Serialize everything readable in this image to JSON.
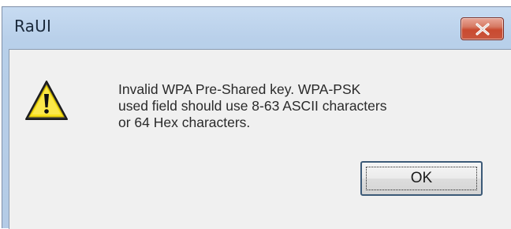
{
  "window": {
    "title": "RaUI",
    "close_icon": "close-icon"
  },
  "dialog": {
    "icon": "warning-icon",
    "message_lines": [
      "Invalid WPA Pre-Shared key. WPA-PSK",
      "used field should use 8-63 ASCII characters",
      "or 64 Hex characters."
    ],
    "ok_label": "OK"
  },
  "colors": {
    "titlebar": "#b9d0ea",
    "client_background": "#f0f0f0",
    "close_button": "#c94a30",
    "warning_fill": "#f7e01a"
  }
}
